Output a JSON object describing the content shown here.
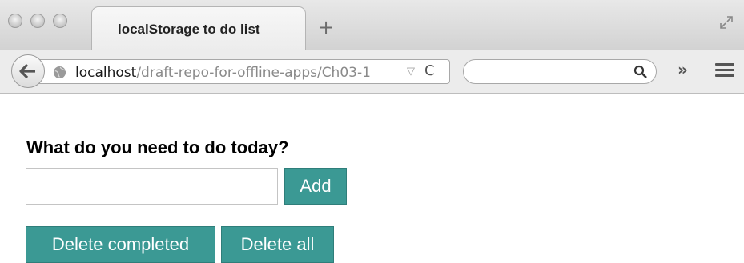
{
  "browser": {
    "tab_title": "localStorage to do list",
    "new_tab_glyph": "+",
    "url_host": "localhost",
    "url_path": "/draft-repo-for-offline-apps/Ch03-1",
    "reload_glyph": "C",
    "dropdown_glyph": "▽",
    "overflow_glyph": "»",
    "search_placeholder": "",
    "icons": [
      "back-arrow-icon",
      "globe-icon",
      "search-icon",
      "menu-icon",
      "fullscreen-icon"
    ]
  },
  "page": {
    "heading": "What do you need to do today?",
    "input_value": "",
    "add_label": "Add",
    "delete_completed_label": "Delete completed",
    "delete_all_label": "Delete all"
  },
  "colors": {
    "button_bg": "#3b9994",
    "button_text": "#ffffff"
  }
}
